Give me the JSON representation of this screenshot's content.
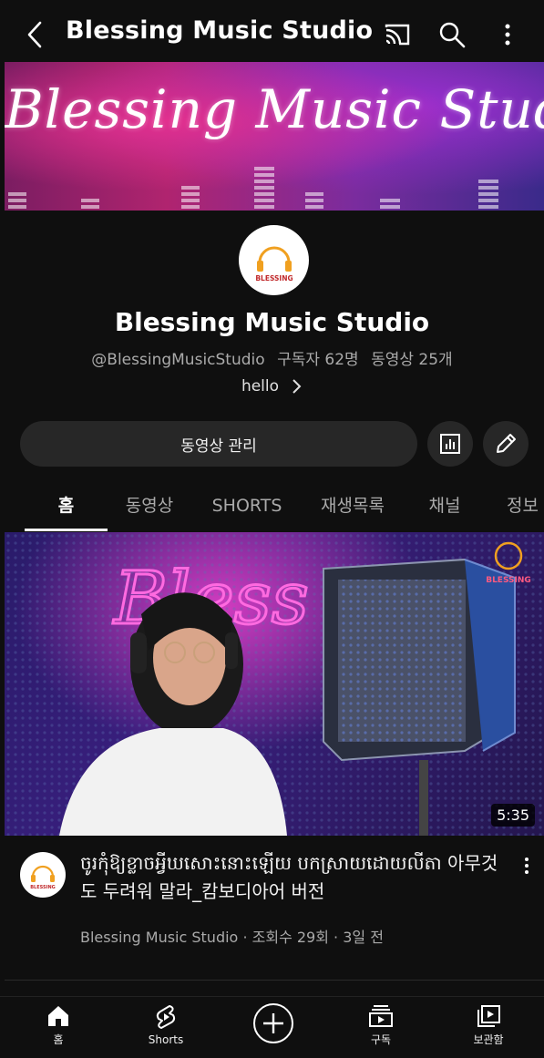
{
  "header": {
    "title": "Blessing Music Studio",
    "icons": [
      "back-icon",
      "cast-icon",
      "search-icon",
      "more-vert-icon"
    ]
  },
  "banner": {
    "text": "Blessing Music Studio"
  },
  "channel": {
    "avatar_text": "BLESSING",
    "name": "Blessing Music Studio",
    "handle": "@BlessingMusicStudio",
    "subscribers": "구독자 62명",
    "videos": "동영상 25개",
    "description": "hello"
  },
  "actions": {
    "manage_label": "동영상 관리",
    "analytics_icon": "analytics-icon",
    "edit_icon": "edit-icon"
  },
  "tabs": [
    "홈",
    "동영상",
    "SHORTS",
    "재생목록",
    "채널",
    "정보"
  ],
  "active_tab": "홈",
  "video": {
    "thumbnail_text": "Bless",
    "thumbnail_logo": "BLESSING",
    "duration": "5:35",
    "title": "ចូរកុំឱ្យខ្លាចអ្វីឃសោះនោះឡើយ បកស្រាយដោយលីតា 아무것도 두려워 말라_캄보디아어 버전",
    "channel": "Blessing Music Studio",
    "views": "조회수 29회",
    "age": "3일 전",
    "separator": "·"
  },
  "bottom_nav": [
    {
      "label": "홈",
      "icon": "home-icon"
    },
    {
      "label": "Shorts",
      "icon": "shorts-icon"
    },
    {
      "label": "",
      "icon": "create-icon"
    },
    {
      "label": "구독",
      "icon": "subscriptions-icon"
    },
    {
      "label": "보관함",
      "icon": "library-icon"
    }
  ],
  "colors": {
    "background": "#0f0f0f",
    "surface": "#272727",
    "text_primary": "#f1f1f1",
    "text_secondary": "#aaaaaa"
  }
}
